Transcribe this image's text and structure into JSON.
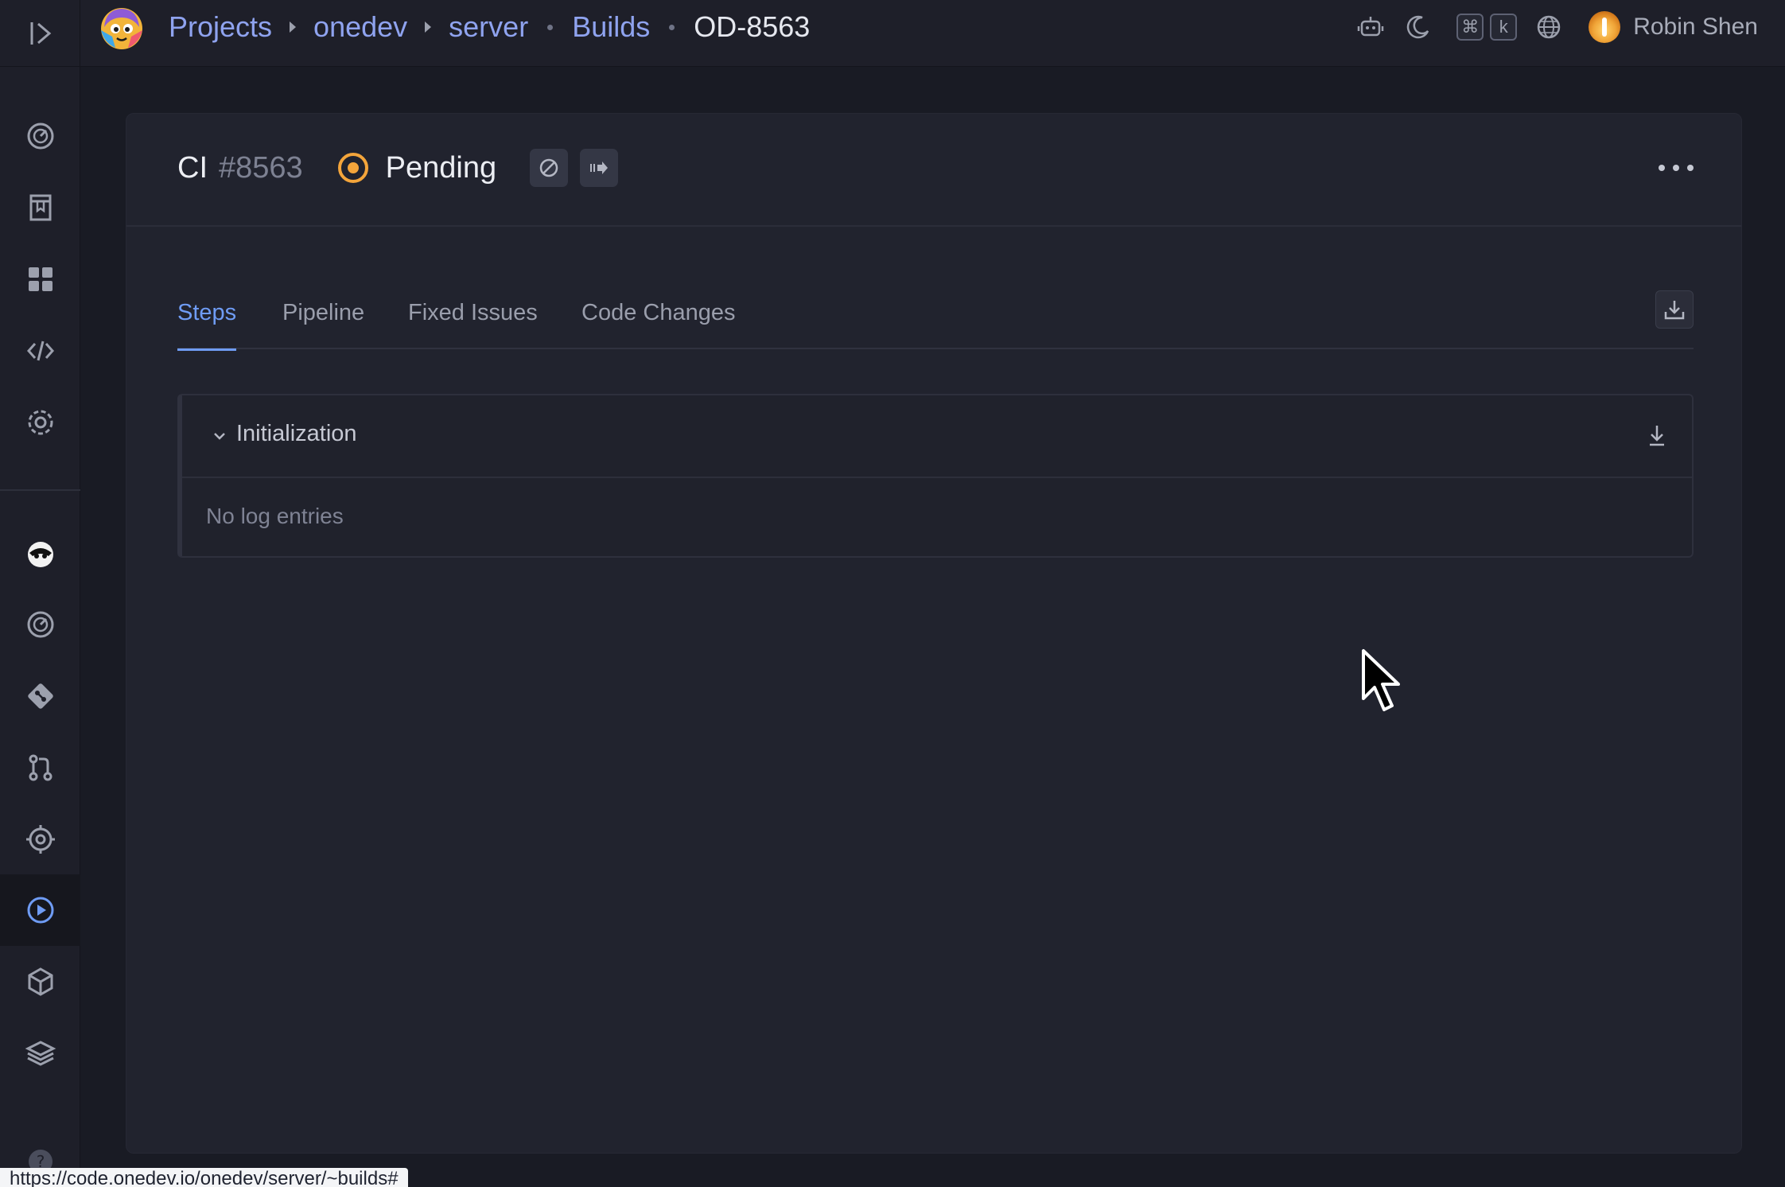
{
  "topbar": {
    "breadcrumb": {
      "projects": "Projects",
      "project": "onedev",
      "subproject": "server",
      "section": "Builds",
      "current": "OD-8563"
    },
    "kbd_mod": "⌘",
    "kbd_key": "k",
    "user_name": "Robin Shen"
  },
  "build": {
    "job": "CI",
    "number": "#8563",
    "status": "Pending",
    "status_color": "#f4a53b"
  },
  "tabs": [
    {
      "label": "Steps",
      "active": true
    },
    {
      "label": "Pipeline",
      "active": false
    },
    {
      "label": "Fixed Issues",
      "active": false
    },
    {
      "label": "Code Changes",
      "active": false
    }
  ],
  "step": {
    "name": "Initialization",
    "empty_text": "No log entries"
  },
  "status_url": "https://code.onedev.io/onedev/server/~builds#",
  "colors": {
    "accent": "#6f9cf5",
    "link": "#8fa3ef",
    "pending": "#f4a53b"
  }
}
